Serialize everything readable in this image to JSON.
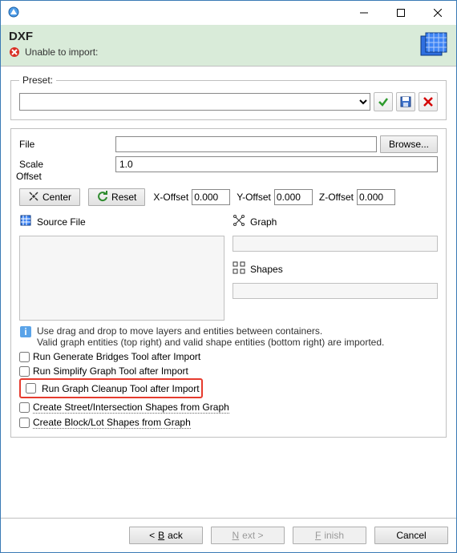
{
  "window": {
    "title": ""
  },
  "header": {
    "title": "DXF",
    "status": "Unable to import:"
  },
  "preset": {
    "legend": "Preset:",
    "value": ""
  },
  "file": {
    "file_label": "File",
    "file_value": "",
    "browse_label": "Browse...",
    "scale_label": "Scale",
    "scale_value": "1.0",
    "offset_label": "Offset",
    "center_label": "Center",
    "reset_label": "Reset",
    "x_label": "X-Offset",
    "x_value": "0.000",
    "y_label": "Y-Offset",
    "y_value": "0.000",
    "z_label": "Z-Offset",
    "z_value": "0.000"
  },
  "bins": {
    "source": "Source File",
    "graph": "Graph",
    "shapes": "Shapes"
  },
  "hint": {
    "line1": "Use drag and drop to move layers and entities between containers.",
    "line2": "Valid graph entities (top right) and valid shape entities (bottom right) are imported."
  },
  "checks": {
    "c1": "Run Generate Bridges Tool after Import",
    "c2": "Run Simplify Graph Tool after Import",
    "c3": "Run Graph Cleanup Tool after Import",
    "c4": "Create Street/Intersection Shapes from Graph",
    "c5": "Create Block/Lot Shapes from Graph"
  },
  "footer": {
    "back": "Back",
    "next": "Next >",
    "finish": "Finish",
    "cancel": "Cancel"
  }
}
